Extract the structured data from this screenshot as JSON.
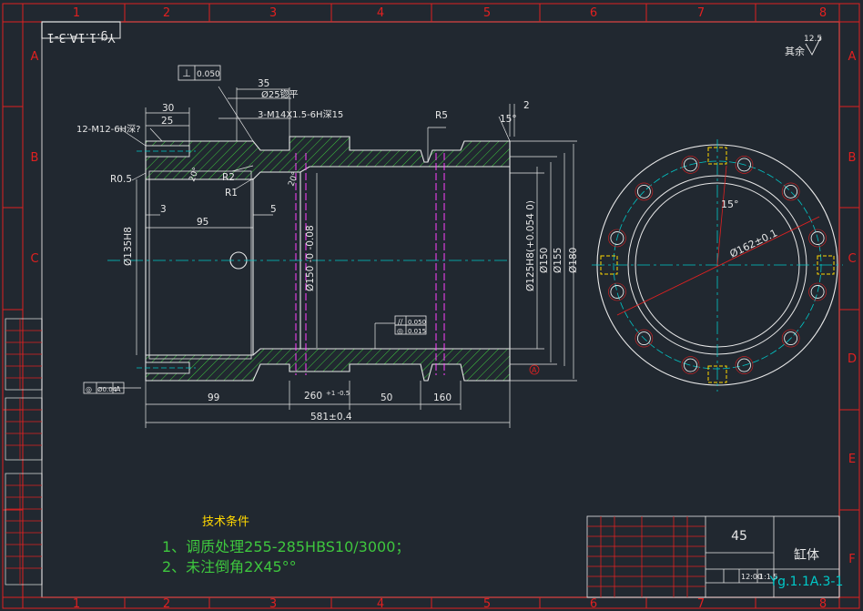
{
  "sheet": {
    "drawing_number": "Yg.1.1A.3-1",
    "col_labels": [
      "1",
      "2",
      "3",
      "4",
      "5",
      "6",
      "7",
      "8"
    ],
    "row_labels": [
      "A",
      "B",
      "C",
      "D",
      "E",
      "F"
    ]
  },
  "roughness": {
    "label": "其余",
    "value": "12.5"
  },
  "tech": {
    "title": "技术条件",
    "lines": [
      "1、调质处理255-285HBS10/3000；",
      "2、未注倒角2X45°°"
    ]
  },
  "title_block": {
    "material": "45",
    "part_name": "缸体",
    "drawing_number": "Yg.1.1A.3-1",
    "scale_a": "12:00",
    "scale_b": "1:1.5"
  },
  "dims": {
    "perp_tol": "0.050",
    "d30": "30",
    "d25": "25",
    "d35": "35",
    "hole25": "Ø25锪平",
    "thread3": "3-M14X1.5-6H深15",
    "thread12": "12-M12-6H深?",
    "r5": "R5",
    "d2": "2",
    "d15deg": "15°",
    "r05": "R0.5",
    "r2": "R2",
    "r1": "R1",
    "a20": "20°",
    "a20b": "20°",
    "d3": "3",
    "d95": "95",
    "d5": "5",
    "d135": "Ø135H8",
    "d150bore": "Ø150 -0 -0.08",
    "d125": "Ø125H8(+0.054 0)",
    "d150": "Ø150",
    "d155": "Ø155",
    "d180": "Ø180",
    "par_tol": "0.050",
    "cyl_tol": "0.015",
    "coax_tol": "Ø0.04",
    "datum": "A",
    "d99": "99",
    "d260": "260",
    "d260tol": "+1 -0.5",
    "d50": "50",
    "d160": "160",
    "d581": "581±0.4",
    "side_15": "15°",
    "side_162": "Ø162±0.1"
  }
}
